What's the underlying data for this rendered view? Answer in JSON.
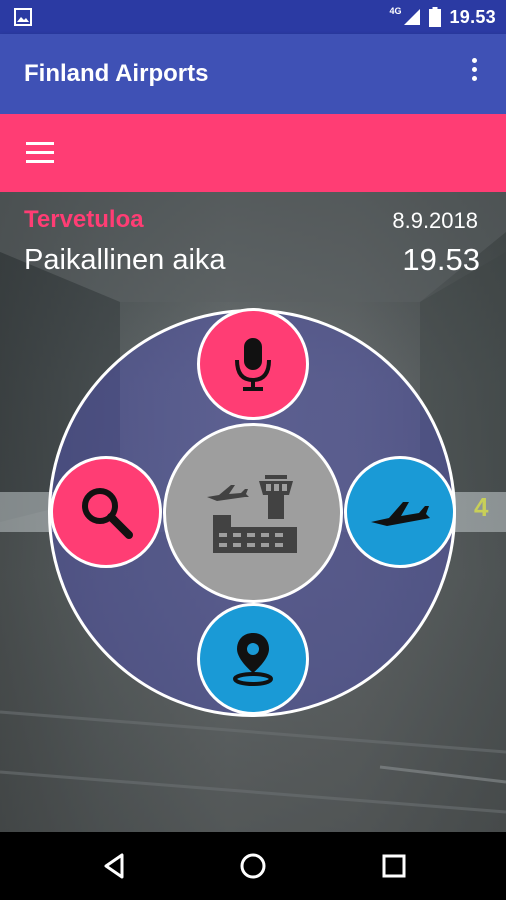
{
  "status_bar": {
    "time": "19.53",
    "network": "4G",
    "icons": [
      "image-notification-icon",
      "signal-icon",
      "battery-icon"
    ]
  },
  "app_bar": {
    "title": "Finland Airports",
    "overflow_icon": "more-vert-icon"
  },
  "toolbar": {
    "menu_icon": "hamburger-menu-icon"
  },
  "main": {
    "welcome": "Tervetuloa",
    "date": "8.9.2018",
    "local_time_label": "Paikallinen aika",
    "local_time": "19.53",
    "background_gate_number": "4",
    "wheel": {
      "center": "airport-icon",
      "top": "microphone-icon",
      "left": "search-icon",
      "right": "airplane-icon",
      "bottom": "location-pin-icon"
    }
  },
  "navigation": [
    "back-icon",
    "home-icon",
    "recents-icon"
  ],
  "colors": {
    "status_bar": "#2b3aa3",
    "app_bar": "#3f51b5",
    "accent_pink": "#ff3d74",
    "accent_blue": "#1a9ad6",
    "center_gray": "#9e9e9e"
  }
}
